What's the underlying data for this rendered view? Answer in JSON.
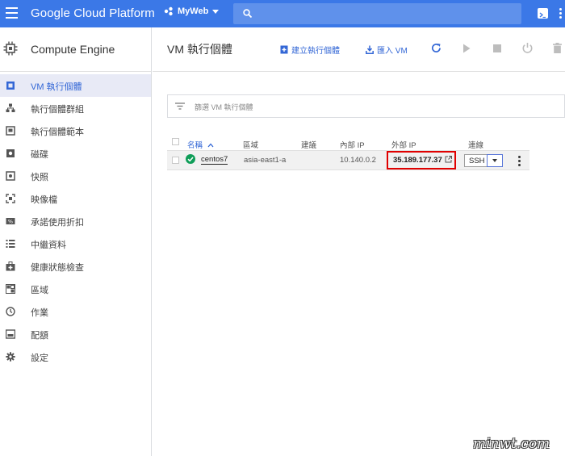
{
  "topbar": {
    "brand": "Google Cloud Platform",
    "project": "MyWeb",
    "color": "#3b78e7"
  },
  "sidebar": {
    "product": "Compute Engine",
    "items": [
      {
        "label": "VM 執行個體",
        "icon": "vm-instances-icon",
        "active": true
      },
      {
        "label": "執行個體群組",
        "icon": "instance-groups-icon"
      },
      {
        "label": "執行個體範本",
        "icon": "instance-templates-icon"
      },
      {
        "label": "磁碟",
        "icon": "disk-icon"
      },
      {
        "label": "快照",
        "icon": "snapshot-icon"
      },
      {
        "label": "映像檔",
        "icon": "image-icon"
      },
      {
        "label": "承諾使用折扣",
        "icon": "discount-icon"
      },
      {
        "label": "中繼資料",
        "icon": "metadata-icon"
      },
      {
        "label": "健康狀態檢查",
        "icon": "health-check-icon"
      },
      {
        "label": "區域",
        "icon": "zones-icon"
      },
      {
        "label": "作業",
        "icon": "operations-icon"
      },
      {
        "label": "配額",
        "icon": "quotas-icon"
      },
      {
        "label": "設定",
        "icon": "settings-icon"
      }
    ]
  },
  "main": {
    "title": "VM 執行個體",
    "toolbar": {
      "create": "建立執行個體",
      "import": "匯入 VM"
    },
    "filter_placeholder": "篩選 VM 執行個體",
    "columns": {
      "name": "名稱",
      "zone": "區域",
      "recommendation": "建議",
      "internal_ip": "內部 IP",
      "external_ip": "外部 IP",
      "connect": "連線"
    },
    "rows": [
      {
        "name": "centos7",
        "zone": "asia-east1-a",
        "recommendation": "",
        "internal_ip": "10.140.0.2",
        "external_ip": "35.189.177.37",
        "connect": "SSH",
        "status": "running"
      }
    ]
  },
  "watermark": "minwt.com",
  "colors": {
    "accent": "#3367d6",
    "active_bg": "#e8eaf6",
    "highlight": "#e00000",
    "status_ok": "#0f9d58"
  }
}
